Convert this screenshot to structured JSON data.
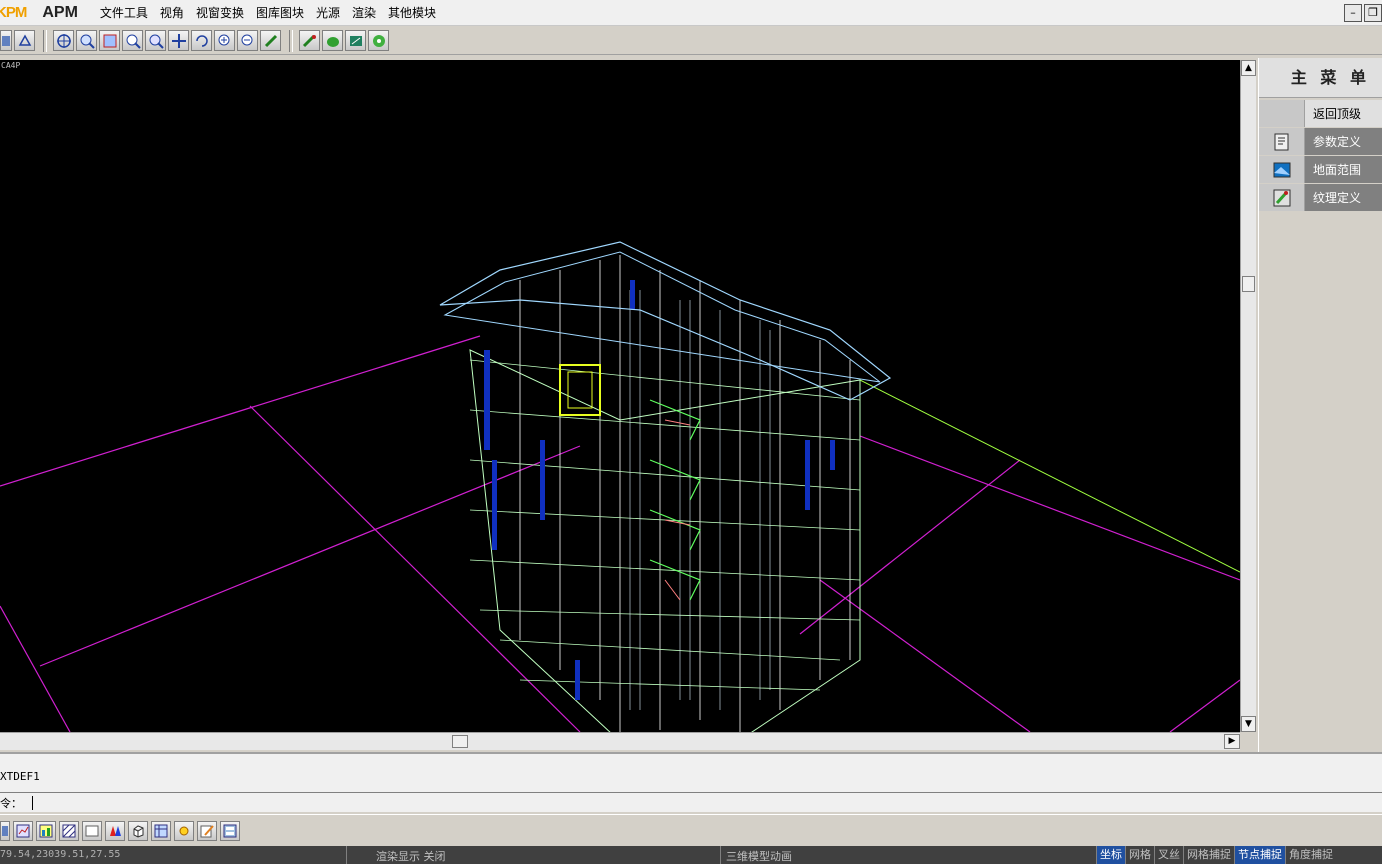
{
  "app": {
    "logo_pkpm": "KPM",
    "logo_apm": "APM"
  },
  "menu": {
    "items": [
      "文件工具",
      "视角",
      "视窗变换",
      "图库图块",
      "光源",
      "渲染",
      "其他模块"
    ]
  },
  "toolbar": {
    "icons": [
      "view-icon",
      "fill-icon",
      "target-icon",
      "zoom-in-icon",
      "zoom-fit-icon",
      "zoom-window-icon",
      "zoom-icon",
      "pan-icon",
      "rotate-icon",
      "zoom-plus-icon",
      "zoom-minus-icon",
      "redraw-icon",
      "render-icon-1",
      "render-icon-2",
      "render-icon-3",
      "render-icon-4"
    ]
  },
  "viewport": {
    "label": "CA4P"
  },
  "side_menu": {
    "title": "主 菜 单",
    "back_label": "返回顶级",
    "items": [
      {
        "label": "参数定义",
        "icon": "parameters-icon"
      },
      {
        "label": "地面范围",
        "icon": "ground-range-icon"
      },
      {
        "label": "纹理定义",
        "icon": "texture-icon"
      }
    ]
  },
  "command": {
    "history_line": "XTDEF1",
    "prompt": "令："
  },
  "status": {
    "coords": "79.54,23039.51,27.55",
    "render_display": "渲染显示 关闭",
    "mode": "三维模型动画",
    "toggles": [
      {
        "label": "坐标",
        "on": true
      },
      {
        "label": "网格",
        "on": false
      },
      {
        "label": "叉丝",
        "on": false
      },
      {
        "label": "网格捕捉",
        "on": false
      },
      {
        "label": "节点捕捉",
        "on": true
      },
      {
        "label": "角度捕捉",
        "on": false
      }
    ]
  }
}
